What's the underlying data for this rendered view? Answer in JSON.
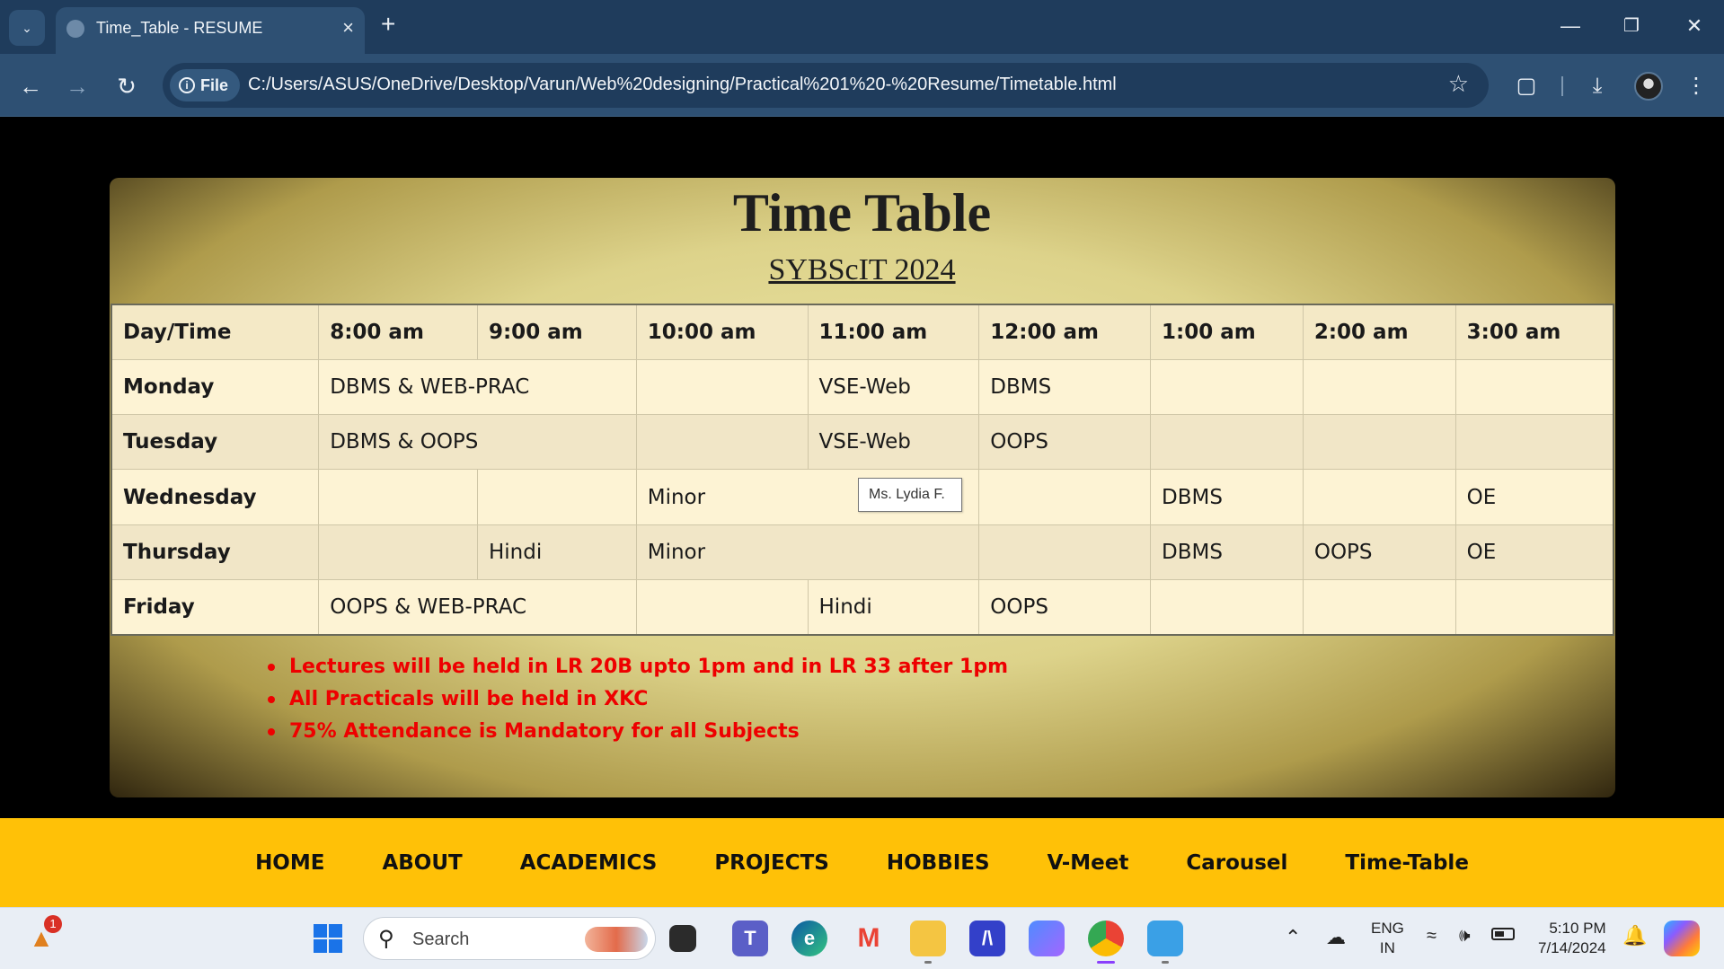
{
  "browser": {
    "tab_title": "Time_Table - RESUME",
    "url": "C:/Users/ASUS/OneDrive/Desktop/Varun/Web%20designing/Practical%201%20-%20Resume/Timetable.html",
    "scheme_label": "File"
  },
  "page": {
    "title": "Time Table",
    "subtitle": "SYBScIT 2024",
    "table": {
      "headers": [
        "Day/Time",
        "8:00 am",
        "9:00 am",
        "10:00 am",
        "11:00 am",
        "12:00 am",
        "1:00 am",
        "2:00 am",
        "3:00 am"
      ],
      "rows": {
        "monday": {
          "day": "Monday",
          "c1": "DBMS & WEB-PRAC",
          "c3": "",
          "c4": "VSE-Web",
          "c5": "DBMS",
          "c6": "",
          "c7": "",
          "c8": ""
        },
        "tuesday": {
          "day": "Tuesday",
          "c1": "DBMS & OOPS",
          "c3": "",
          "c4": "VSE-Web",
          "c5": "OOPS",
          "c6": "",
          "c7": "",
          "c8": ""
        },
        "wednesday": {
          "day": "Wednesday",
          "c1": "",
          "c2": "",
          "c3": "Minor",
          "c5": "",
          "c6": "DBMS",
          "c7": "",
          "c8": "OE"
        },
        "thursday": {
          "day": "Thursday",
          "c1": "",
          "c2": "Hindi",
          "c3": "Minor",
          "c5": "",
          "c6": "DBMS",
          "c7": "OOPS",
          "c8": "OE"
        },
        "friday": {
          "day": "Friday",
          "c1": "OOPS & WEB-PRAC",
          "c3": "",
          "c4": "Hindi",
          "c5": "OOPS",
          "c6": "",
          "c7": "",
          "c8": ""
        }
      }
    },
    "tooltip": "Ms. Lydia F.",
    "notes": [
      "Lectures will be held in LR 20B upto 1pm and in LR 33 after 1pm",
      "All Practicals will be held in XKC",
      "75% Attendance is Mandatory for all Subjects"
    ],
    "nav": [
      "HOME",
      "ABOUT",
      "ACADEMICS",
      "PROJECTS",
      "HOBBIES",
      "V-Meet",
      "Carousel",
      "Time-Table"
    ]
  },
  "taskbar": {
    "search_placeholder": "Search",
    "widgets_badge": "1",
    "lang_line1": "ENG",
    "lang_line2": "IN",
    "time": "5:10 PM",
    "date": "7/14/2024"
  },
  "colors": {
    "footer_bg": "#ffc107",
    "notes_red": "#ee0000",
    "chrome_dark": "#1f3c5c",
    "chrome_toolbar": "#2e5073"
  }
}
